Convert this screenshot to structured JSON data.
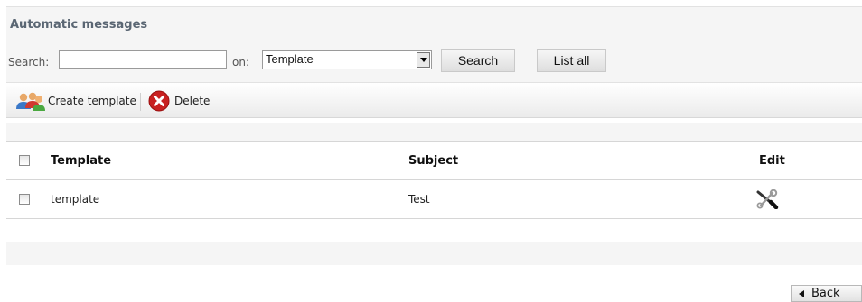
{
  "header": {
    "title": "Automatic messages"
  },
  "search": {
    "label": "Search:",
    "value": "",
    "on_label": "on:",
    "field_selected": "Template",
    "search_button": "Search",
    "list_all_button": "List all"
  },
  "toolbar": {
    "create_label": "Create template",
    "create_icon": "users-add-icon",
    "delete_label": "Delete",
    "delete_icon": "delete-x-icon",
    "delete_color": "#cc2020"
  },
  "table": {
    "columns": [
      "Template",
      "Subject",
      "Edit"
    ],
    "rows": [
      {
        "template": "template",
        "subject": "Test",
        "edit_icon": "wrench-screwdriver-icon"
      }
    ]
  },
  "footer": {
    "back_label": "Back"
  }
}
